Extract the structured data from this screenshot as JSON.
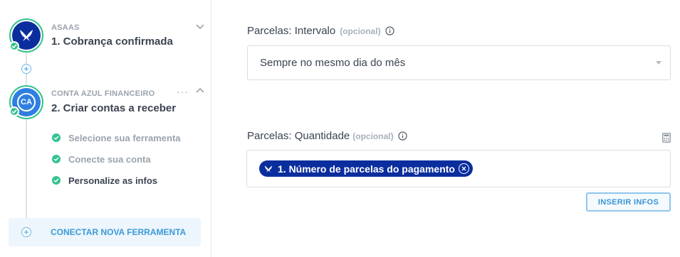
{
  "sidebar": {
    "steps": [
      {
        "app_name": "ASAAS",
        "title": "1. Cobrança confirmada",
        "icon": "asaas-logo-icon",
        "status": "complete",
        "expanded": false
      },
      {
        "app_name": "CONTA AZUL FINANCEIRO",
        "title": "2. Criar contas a receber",
        "icon_text": "CA",
        "status": "complete",
        "expanded": true,
        "substeps": [
          {
            "label": "Selecione sua ferramenta",
            "status": "complete",
            "active": false
          },
          {
            "label": "Conecte sua conta",
            "status": "complete",
            "active": false
          },
          {
            "label": "Personalize as infos",
            "status": "complete",
            "active": true
          }
        ]
      }
    ],
    "more_label": "···",
    "connect_label": "CONECTAR NOVA FERRAMENTA"
  },
  "main": {
    "interval_field": {
      "label": "Parcelas: Intervalo",
      "optional": "(opcional)",
      "value": "Sempre no mesmo dia do mês"
    },
    "quantity_field": {
      "label": "Parcelas: Quantidade",
      "optional": "(opcional)",
      "tag": "1. Número de parcelas do pagamento"
    },
    "insert_button": "INSERIR INFOS"
  },
  "colors": {
    "success": "#34c38f",
    "asaas_blue": "#0b2e9e",
    "conta_azul_blue": "#2f7fe0",
    "link_blue": "#3b99d8",
    "text_primary": "#3a4350",
    "text_muted": "#9aa3ad"
  }
}
